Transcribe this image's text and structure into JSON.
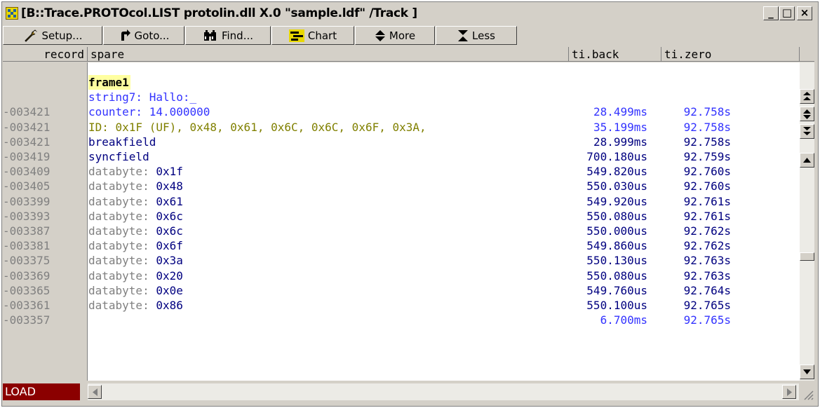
{
  "window": {
    "title": "[B::Trace.PROTOcol.LIST protolin.dll X.0 \"sample.ldf\" /Track ]",
    "controls": {
      "minimize": "_",
      "maximize": "□",
      "close": "×"
    }
  },
  "toolbar": {
    "setup": "Setup...",
    "goto": "Goto...",
    "find": "Find...",
    "chart": "Chart",
    "more": "More",
    "less": "Less"
  },
  "columns": {
    "record": "record",
    "spare": "spare",
    "ti_back": "ti.back",
    "ti_zero": "ti.zero"
  },
  "rows": [
    {
      "record": "",
      "text": "frame1",
      "back": "",
      "zero": "",
      "style": "frame"
    },
    {
      "record": "",
      "text": "string7: Hallo:_",
      "back": "",
      "zero": "",
      "style": "blue"
    },
    {
      "record": "-003421",
      "text": "counter: 14.000000",
      "back": "28.499ms",
      "zero": "92.758s",
      "style": "blue"
    },
    {
      "record": "-003421",
      "text": "ID: 0x1F (UF), 0x48, 0x61, 0x6C, 0x6C, 0x6F, 0x3A,",
      "back": "35.199ms",
      "zero": "92.758s",
      "style": "olive"
    },
    {
      "record": "-003421",
      "text": "breakfield",
      "back": "28.999ms",
      "zero": "92.758s",
      "style": "navy"
    },
    {
      "record": "-003419",
      "text": "syncfield",
      "back": "700.180us",
      "zero": "92.759s",
      "style": "navy"
    },
    {
      "record": "-003409",
      "label": "databyte: ",
      "value": "0x1f",
      "back": "549.820us",
      "zero": "92.760s",
      "style": "data"
    },
    {
      "record": "-003405",
      "label": "databyte: ",
      "value": "0x48",
      "back": "550.030us",
      "zero": "92.760s",
      "style": "data"
    },
    {
      "record": "-003399",
      "label": "databyte: ",
      "value": "0x61",
      "back": "549.920us",
      "zero": "92.761s",
      "style": "data"
    },
    {
      "record": "-003393",
      "label": "databyte: ",
      "value": "0x6c",
      "back": "550.080us",
      "zero": "92.761s",
      "style": "data"
    },
    {
      "record": "-003387",
      "label": "databyte: ",
      "value": "0x6c",
      "back": "550.000us",
      "zero": "92.762s",
      "style": "data"
    },
    {
      "record": "-003381",
      "label": "databyte: ",
      "value": "0x6f",
      "back": "549.860us",
      "zero": "92.762s",
      "style": "data"
    },
    {
      "record": "-003375",
      "label": "databyte: ",
      "value": "0x3a",
      "back": "550.130us",
      "zero": "92.763s",
      "style": "data"
    },
    {
      "record": "-003369",
      "label": "databyte: ",
      "value": "0x20",
      "back": "550.080us",
      "zero": "92.763s",
      "style": "data"
    },
    {
      "record": "-003365",
      "label": "databyte: ",
      "value": "0x0e",
      "back": "549.760us",
      "zero": "92.764s",
      "style": "data"
    },
    {
      "record": "-003361",
      "label": "databyte: ",
      "value": "0x86",
      "back": "550.100us",
      "zero": "92.765s",
      "style": "data"
    },
    {
      "record": "-003357",
      "text": "",
      "back": "6.700ms",
      "zero": "92.765s",
      "style": "blue"
    }
  ],
  "status": {
    "state": "LOAD"
  },
  "colors": {
    "blue": "#3333ff",
    "olive": "#808000",
    "navy": "#000080",
    "gray": "#808080",
    "frame_bg": "#ffffa0",
    "load_bg": "#8b0000"
  }
}
